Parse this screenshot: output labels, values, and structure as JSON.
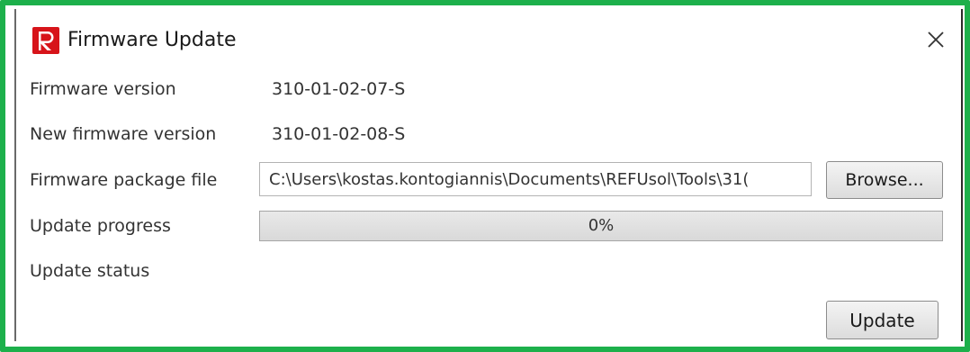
{
  "window": {
    "title": "Firmware Update",
    "logo_icon": "refu-r-logo-icon",
    "close_icon": "close-icon",
    "border_color": "#1db04b",
    "logo_color": "#d7141a"
  },
  "fields": {
    "firmware_version": {
      "label": "Firmware version",
      "value": "310-01-02-07-S"
    },
    "new_firmware_version": {
      "label": "New firmware version",
      "value": "310-01-02-08-S"
    },
    "package_file": {
      "label": "Firmware package file",
      "value": "C:\\Users\\kostas.kontogiannis\\Documents\\REFUsol\\Tools\\31(",
      "browse_label": "Browse..."
    },
    "update_progress": {
      "label": "Update progress",
      "percent": 0,
      "text": "0%"
    },
    "update_status": {
      "label": "Update status",
      "value": ""
    }
  },
  "actions": {
    "update_label": "Update"
  }
}
